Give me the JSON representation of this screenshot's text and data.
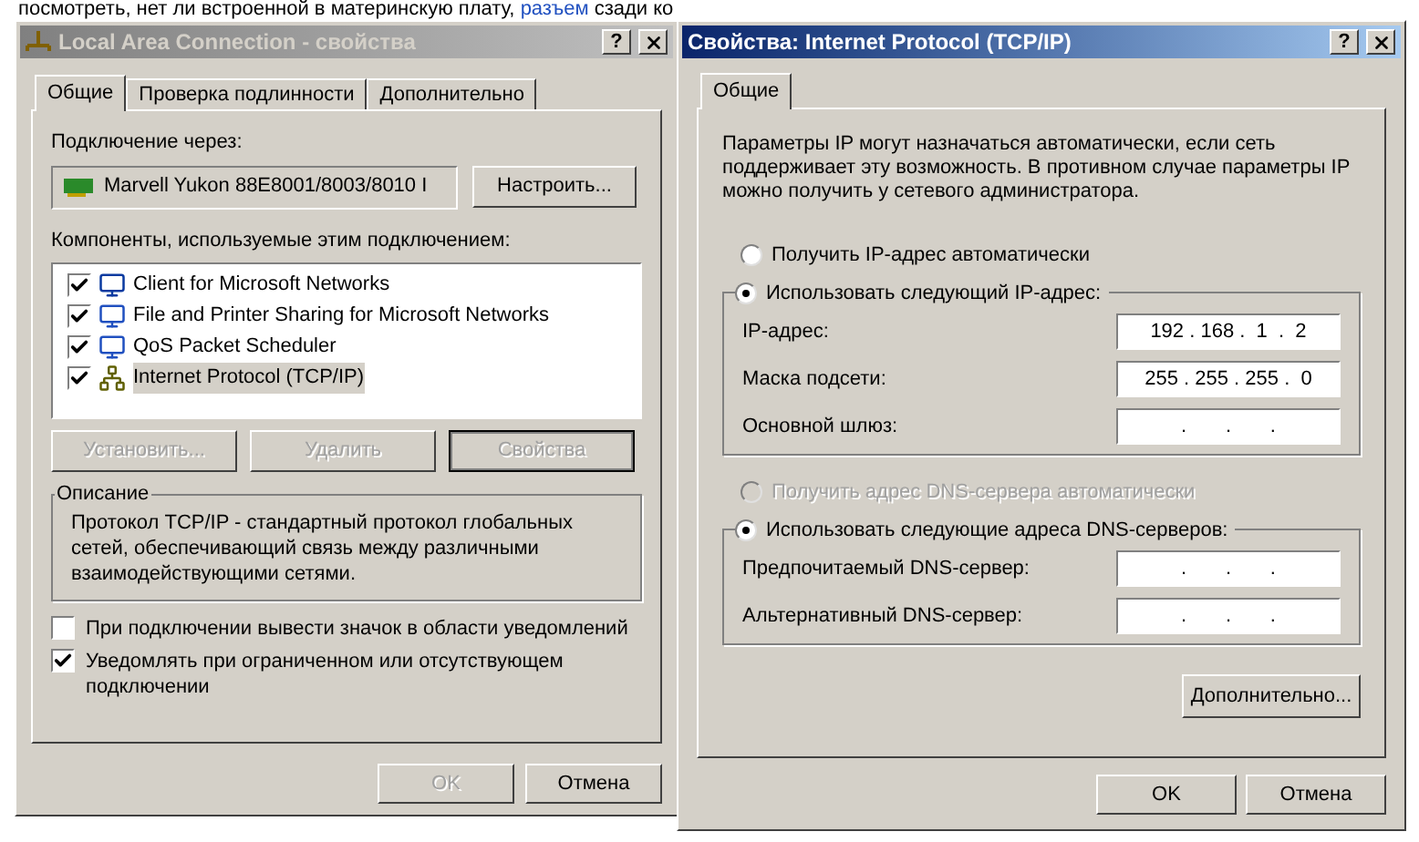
{
  "page_text": {
    "before_link": "посмотреть, нет ли встроенной в материнскую плату,",
    "link": "разъем",
    "after_link": "сзади ко"
  },
  "left_dialog": {
    "title": "Local Area Connection - свойства",
    "active": false,
    "help": "?",
    "tabs": [
      {
        "label": "Общие",
        "selected": true
      },
      {
        "label": "Проверка подлинности",
        "selected": false
      },
      {
        "label": "Дополнительно",
        "selected": false
      }
    ],
    "connect_label": "Подключение через:",
    "adapter": "Marvell Yukon 88E8001/8003/8010 I",
    "configure_button": "Настроить...",
    "components_label": "Компоненты, используемые этим подключением:",
    "components": [
      {
        "name": "Client for Microsoft Networks",
        "kind": "client",
        "checked": true,
        "selected": false
      },
      {
        "name": "File and Printer Sharing for Microsoft Networks",
        "kind": "service",
        "checked": true,
        "selected": false
      },
      {
        "name": "QoS Packet Scheduler",
        "kind": "service",
        "checked": true,
        "selected": false
      },
      {
        "name": "Internet Protocol (TCP/IP)",
        "kind": "protocol",
        "checked": true,
        "selected": true
      }
    ],
    "buttons": [
      {
        "label": "Установить...",
        "disabled": true,
        "default": false
      },
      {
        "label": "Удалить",
        "disabled": true,
        "default": false
      },
      {
        "label": "Свойства",
        "disabled": true,
        "default": true
      }
    ],
    "description_title": "Описание",
    "description": "Протокол TCP/IP - стандартный протокол глобальных сетей, обеспечивающий связь между различными взаимодействующими сетями.",
    "checkboxes": [
      {
        "label": "При подключении вывести значок в области уведомлений",
        "checked": false
      },
      {
        "label": "Уведомлять при ограниченном или отсутствующем подключении",
        "checked": true
      }
    ],
    "footer_buttons": [
      {
        "label": "OK",
        "disabled": true
      },
      {
        "label": "Отмена",
        "disabled": false
      }
    ]
  },
  "right_dialog": {
    "title": "Свойства: Internet Protocol (TCP/IP)",
    "active": true,
    "help": "?",
    "tabs": [
      {
        "label": "Общие",
        "selected": true
      }
    ],
    "intro": "Параметры IP могут назначаться автоматически, если сеть поддерживает эту возможность. В противном случае параметры IP можно получить у сетевого администратора.",
    "ip_auto": {
      "label": "Получить IP-адрес автоматически",
      "selected": false,
      "disabled": false
    },
    "ip_manual": {
      "label": "Использовать следующий IP-адрес:",
      "selected": true,
      "disabled": false
    },
    "ip_fields": [
      {
        "label": "IP-адрес:",
        "value": "192 . 168 .  1  .  2"
      },
      {
        "label": "Маска подсети:",
        "value": "255 . 255 . 255 .  0"
      },
      {
        "label": "Основной шлюз:",
        "value": ".       .       ."
      }
    ],
    "dns_auto": {
      "label": "Получить адрес DNS-сервера автоматически",
      "selected": false,
      "disabled": true
    },
    "dns_manual": {
      "label": "Использовать следующие адреса DNS-серверов:",
      "selected": true,
      "disabled": false
    },
    "dns_fields": [
      {
        "label": "Предпочитаемый DNS-сервер:",
        "value": ".       .       ."
      },
      {
        "label": "Альтернативный DNS-сервер:",
        "value": ".       .       ."
      }
    ],
    "advanced_button": "Дополнительно...",
    "footer_buttons": [
      {
        "label": "OK",
        "disabled": false
      },
      {
        "label": "Отмена",
        "disabled": false
      }
    ]
  }
}
